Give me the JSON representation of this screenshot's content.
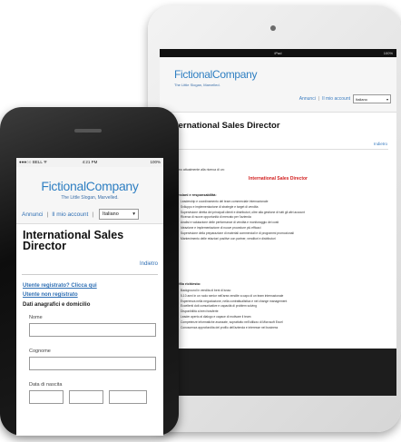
{
  "ipad": {
    "status": {
      "carrier": "iPad",
      "right": "100%"
    },
    "header": {
      "logo": "FictionalCompany",
      "tagline": "The Little Slogan, Marvelled.",
      "nav": {
        "link1": "Annunci",
        "separator": "|",
        "link2": "Il mio account",
        "lang": "Italiano"
      }
    },
    "content": {
      "title": "International Sales Director",
      "back": "Indietro",
      "intro": "Siamo attualmente alla ricerca di un:",
      "job_name": "International Sales Director",
      "section1": "Mansioni e responsabilità:",
      "list1": [
        "Leadership e coordinamento del team commerciale internazionale",
        "Sviluppo e implementazione di strategie e target di vendita",
        "Supervisione diretta dei principali clienti e distributori, oltre alla gestione di tutti gli altri account",
        "Ricerca di nuove opportunità di mercato per l'azienda",
        "Analisi e valutazione delle performance di vendita e monitoraggio dei costi",
        "Ideazione e implementazione di nuove procedure più efficaci",
        "Supervisione della preparazione di materiali commerciali e di programmi promozionali",
        "Mantenimento delle relazioni positive con partner, venditori e distributori"
      ],
      "section2": "Profilo richiesto:",
      "list2": [
        "Background in vendita di beni di lusso",
        "5-10 anni in un ruolo senior nell'area vendite a capo di un team internazionale",
        "Esperienza nella negoziazione, nella contrattualistica e nel change management",
        "Eccellenti doti comunicative e capacità di problem solving",
        "Disponibilità a brevi trasferte",
        "Leader aperto al dialogo e capace di motivare il team",
        "Competenze informatiche avanzate, soprattutto nell'utilizzo di Microsoft Excel",
        "Conoscenza approfondita del profilo dell'azienda e interesse nel business"
      ]
    }
  },
  "iphone": {
    "status": {
      "carrier": "●●●○○ BELL ᯤ",
      "time": "4:21 PM",
      "battery": "100%"
    },
    "header": {
      "logo": "FictionalCompany",
      "tagline": "The Little Slogan, Marvelled.",
      "nav": {
        "link1": "Annunci",
        "separator": "|",
        "link2": "Il mio account",
        "lang": "Italiano"
      }
    },
    "content": {
      "title": "International Sales Director",
      "back": "Indietro",
      "link_registered": "Utente registrato? Clicca qui",
      "link_unregistered": "Utente non registrato",
      "section": "Dati anagrafici e domicilio",
      "label_name": "Nome",
      "label_surname": "Cognome",
      "label_birth": "Data di nascita"
    }
  },
  "colors": {
    "accent_blue": "#2f7fc2",
    "job_red": "#d21f1f"
  },
  "icons": {
    "dropdown": "chevron-down-icon",
    "wifi": "wifi-icon"
  }
}
